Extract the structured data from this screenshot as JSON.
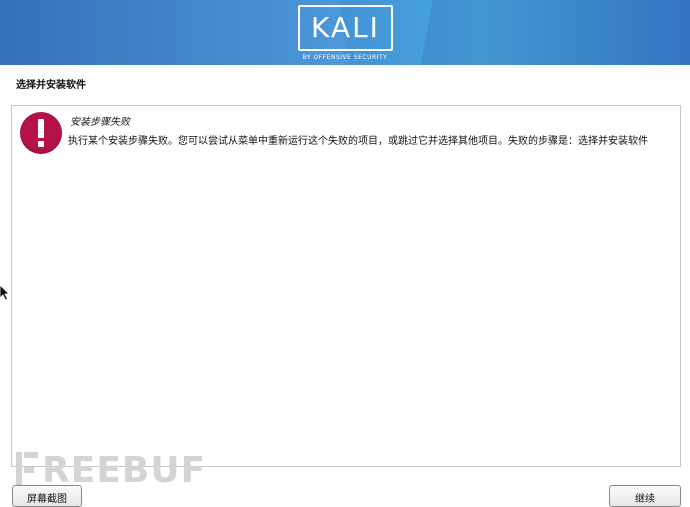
{
  "banner": {
    "logo_text": "KALI",
    "logo_subtitle": "BY OFFENSIVE SECURITY",
    "colors": {
      "left": "#2b67b7",
      "mid": "#4aa7dd",
      "right": "#3a7fcb"
    }
  },
  "page": {
    "title": "选择并安装软件"
  },
  "error": {
    "icon": "exclamation-icon",
    "icon_color": "#b5124a",
    "title": "安装步骤失败",
    "message": "执行某个安装步骤失败。您可以尝试从菜单中重新运行这个失败的项目，或跳过它并选择其他项目。失败的步骤是：选择并安装软件"
  },
  "watermark": {
    "text": "REEBUF"
  },
  "buttons": {
    "screenshot_label": "屏幕截图",
    "continue_label": "继续"
  }
}
